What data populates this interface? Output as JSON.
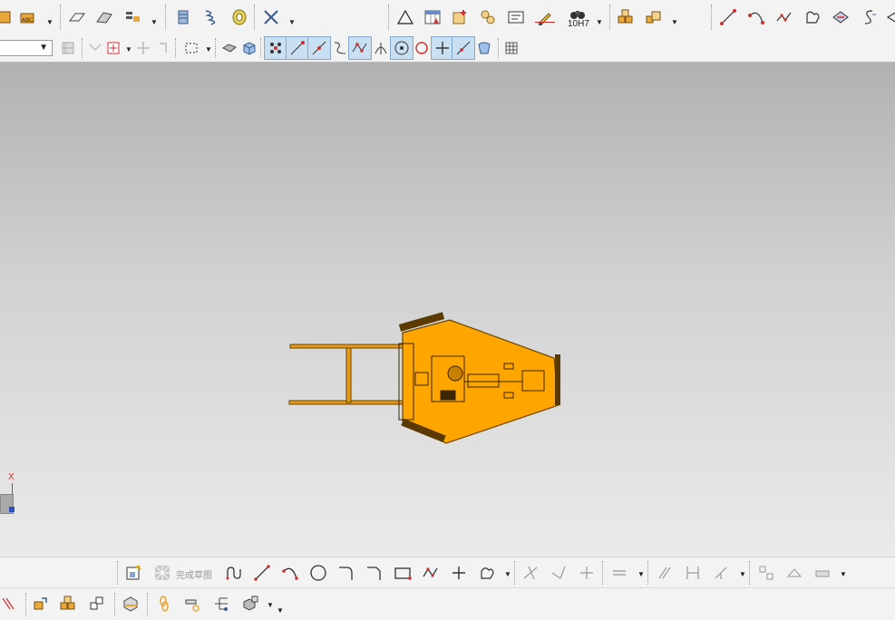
{
  "toolbar_top": {
    "dimension_text": "10H7"
  },
  "toolbar_sketch": {
    "finish_sketch_label": "完成草图"
  },
  "viewport": {
    "axis_label": "X"
  },
  "colors": {
    "model": "#ffa500",
    "accent": "#c03030",
    "viewport_top": "#b2b2b2",
    "viewport_bottom": "#eaeaea"
  }
}
